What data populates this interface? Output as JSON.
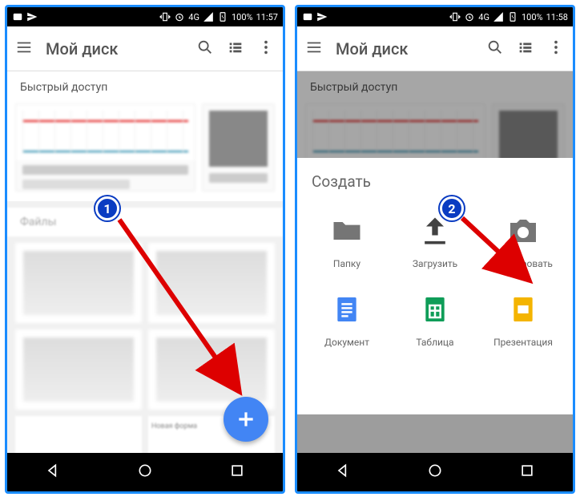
{
  "statusbar": {
    "battery": "100%",
    "time_left": "11:57",
    "time_right": "11:58",
    "network": "4G"
  },
  "appbar": {
    "title": "Мой диск"
  },
  "sections": {
    "quick_access": "Быстрый доступ",
    "files_tab": "Файлы"
  },
  "fab": {
    "label": "+"
  },
  "sheet": {
    "title": "Создать",
    "items": [
      {
        "key": "folder",
        "label": "Папку"
      },
      {
        "key": "upload",
        "label": "Загрузить"
      },
      {
        "key": "scan",
        "label": "Сканировать"
      },
      {
        "key": "doc",
        "label": "Документ"
      },
      {
        "key": "sheet",
        "label": "Таблица"
      },
      {
        "key": "slides",
        "label": "Презентация"
      }
    ]
  },
  "markers": {
    "one": "1",
    "two": "2"
  },
  "quick_stub": {
    "caption": "Новая форма"
  }
}
